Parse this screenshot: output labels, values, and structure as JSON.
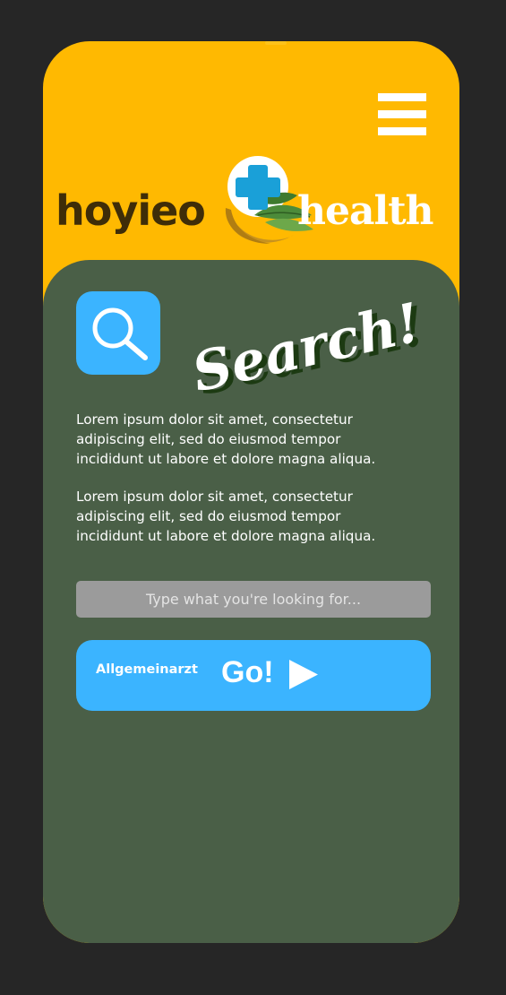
{
  "header": {
    "menu_icon": "hamburger-menu-icon",
    "logo": {
      "word_left": "hoyieo",
      "word_right": "health",
      "emblem_icon": "medical-cross-leaf-icon"
    }
  },
  "search": {
    "icon": "magnifier-icon",
    "heading": "Search!",
    "paragraphs": [
      "Lorem ipsum dolor sit amet, consectetur adipiscing elit, sed do eiusmod tempor incididunt ut labore et dolore magna aliqua.",
      "Lorem ipsum dolor sit amet, consectetur adipiscing elit, sed do eiusmod tempor incididunt ut labore et dolore magna aliqua."
    ],
    "input_placeholder": "Type what you're looking for...",
    "input_value": "",
    "category_label": "Allgemeinarzt",
    "go_label": "Go!",
    "go_icon": "play-triangle-icon"
  },
  "colors": {
    "page_background": "#262626",
    "header_yellow": "#FFB901",
    "panel_green": "#4A5F47",
    "accent_blue": "#3BB4FF",
    "input_gray": "#9B9B9B",
    "logo_brown": "#3F2D08",
    "white": "#FFFFFF"
  }
}
